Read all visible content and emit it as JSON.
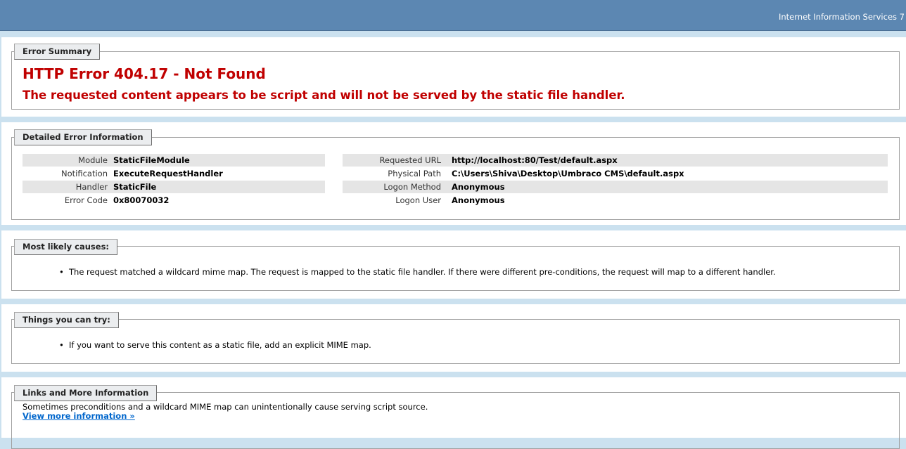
{
  "header": {
    "title": "Internet Information Services 7"
  },
  "error_summary": {
    "legend": "Error Summary",
    "title": "HTTP Error 404.17 - Not Found",
    "subtitle": "The requested content appears to be script and will not be served by the static file handler."
  },
  "detailed": {
    "legend": "Detailed Error Information",
    "left": [
      {
        "label": "Module",
        "value": "StaticFileModule"
      },
      {
        "label": "Notification",
        "value": "ExecuteRequestHandler"
      },
      {
        "label": "Handler",
        "value": "StaticFile"
      },
      {
        "label": "Error Code",
        "value": "0x80070032"
      }
    ],
    "right": [
      {
        "label": "Requested URL",
        "value": "http://localhost:80/Test/default.aspx"
      },
      {
        "label": "Physical Path",
        "value": "C:\\Users\\Shiva\\Desktop\\Umbraco CMS\\default.aspx"
      },
      {
        "label": "Logon Method",
        "value": "Anonymous"
      },
      {
        "label": "Logon User",
        "value": "Anonymous"
      }
    ]
  },
  "causes": {
    "legend": "Most likely causes:",
    "items": [
      "The request matched a wildcard mime map. The request is mapped to the static file handler. If there were different pre-conditions, the request will map to a different handler."
    ]
  },
  "try": {
    "legend": "Things you can try:",
    "items": [
      "If you want to serve this content as a static file, add an explicit MIME map."
    ]
  },
  "links": {
    "legend": "Links and More Information",
    "text": "Sometimes preconditions and a wildcard MIME map can unintentionally cause serving script source.",
    "link_label": "View more information »"
  }
}
